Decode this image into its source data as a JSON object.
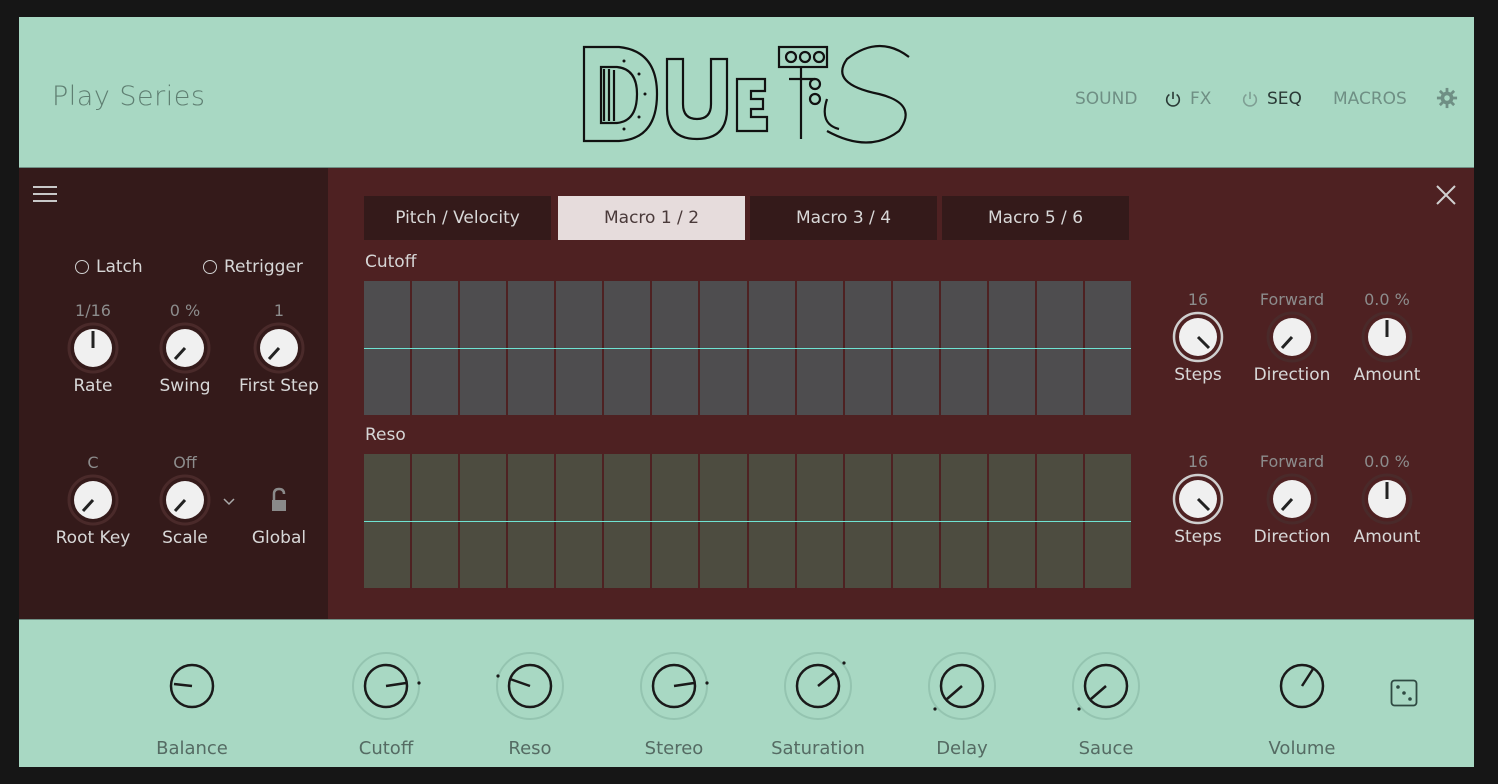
{
  "header": {
    "brand": "Play Series",
    "logo_text": "DUETS",
    "nav": {
      "sound": "SOUND",
      "fx": "FX",
      "seq": "SEQ",
      "macros": "MACROS"
    }
  },
  "sequencer": {
    "options": {
      "latch": "Latch",
      "retrigger": "Retrigger"
    },
    "left_knobs": [
      {
        "value": "1/16",
        "label": "Rate"
      },
      {
        "value": "0 %",
        "label": "Swing"
      },
      {
        "value": "1",
        "label": "First Step"
      },
      {
        "value": "C",
        "label": "Root Key"
      },
      {
        "value": "Off",
        "label": "Scale"
      },
      {
        "value": "",
        "label": "Global"
      }
    ],
    "tabs": [
      "Pitch / Velocity",
      "Macro 1 / 2",
      "Macro 3 / 4",
      "Macro 5 / 6"
    ],
    "active_tab": "Macro 1 / 2",
    "lanes": [
      {
        "title": "Cutoff",
        "steps": {
          "value": "16",
          "label": "Steps"
        },
        "direction": {
          "value": "Forward",
          "label": "Direction"
        },
        "amount": {
          "value": "0.0 %",
          "label": "Amount"
        }
      },
      {
        "title": "Reso",
        "steps": {
          "value": "16",
          "label": "Steps"
        },
        "direction": {
          "value": "Forward",
          "label": "Direction"
        },
        "amount": {
          "value": "0.0 %",
          "label": "Amount"
        }
      }
    ]
  },
  "macros": [
    {
      "label": "Balance"
    },
    {
      "label": "Cutoff"
    },
    {
      "label": "Reso"
    },
    {
      "label": "Stereo"
    },
    {
      "label": "Saturation"
    },
    {
      "label": "Delay"
    },
    {
      "label": "Sauce"
    },
    {
      "label": "Volume"
    }
  ],
  "colors": {
    "accent_line": "#6fe3d3",
    "panel_dark": "#341a1a",
    "panel": "#4e2122",
    "mint": "#a8d8c3"
  }
}
